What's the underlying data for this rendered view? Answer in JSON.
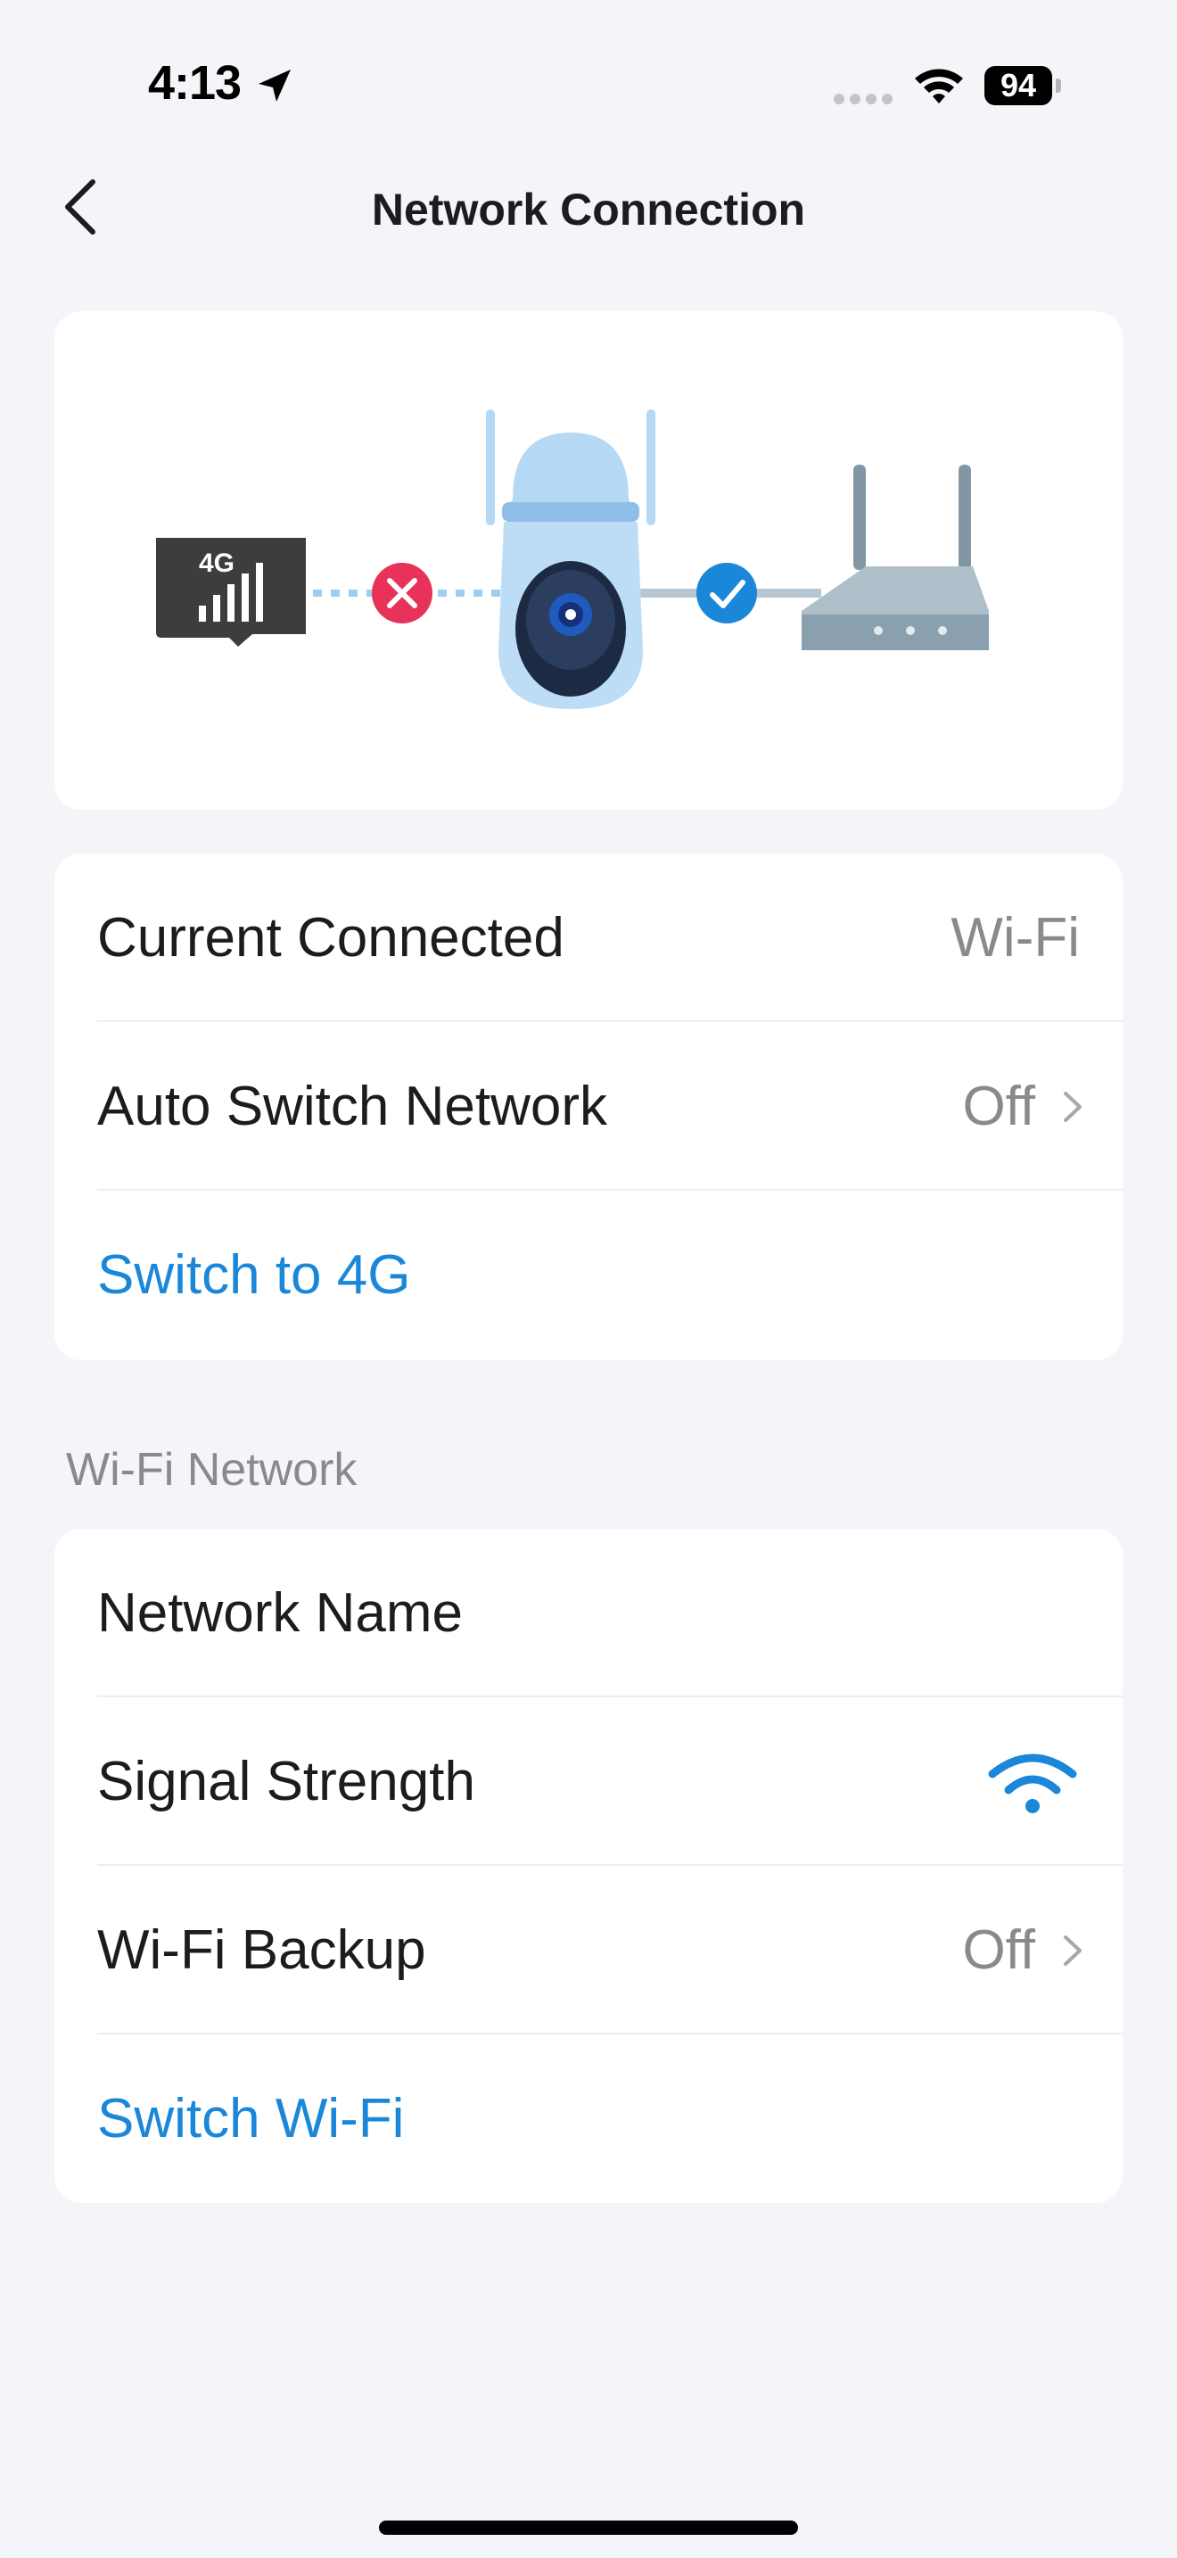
{
  "status_bar": {
    "time": "4:13",
    "battery": "94"
  },
  "nav": {
    "title": "Network Connection"
  },
  "illustration": {
    "sd_card_label": "4G"
  },
  "connection": {
    "current_connected_label": "Current Connected",
    "current_connected_value": "Wi-Fi",
    "auto_switch_label": "Auto Switch Network",
    "auto_switch_value": "Off",
    "switch_action": "Switch to 4G"
  },
  "wifi_network": {
    "section_title": "Wi-Fi Network",
    "network_name_label": "Network Name",
    "signal_strength_label": "Signal Strength",
    "wifi_backup_label": "Wi-Fi Backup",
    "wifi_backup_value": "Off",
    "switch_action": "Switch Wi-Fi"
  },
  "colors": {
    "accent": "#1a87d9",
    "error": "#e8325a",
    "check": "#1a87d9",
    "background": "#f3f5f9"
  },
  "icons": {
    "back": "chevron-left-icon",
    "location": "location-arrow-icon",
    "wifi_status": "wifi-icon",
    "signal": "wifi-signal-icon",
    "chevron": "chevron-right-icon"
  }
}
